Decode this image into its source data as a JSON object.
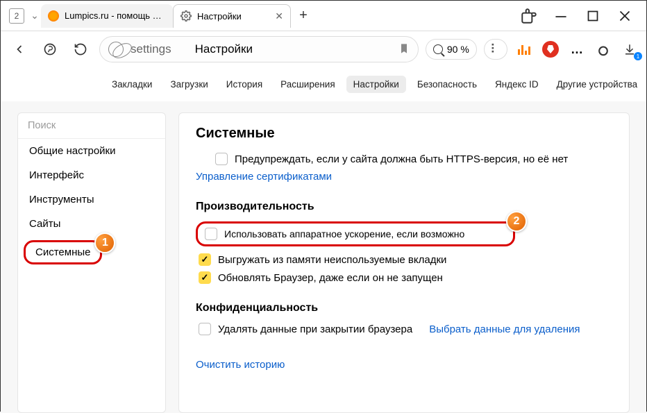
{
  "titlebar": {
    "tab_count": "2",
    "tab_inactive": "Lumpics.ru - помощь с компьютером",
    "tab_active": "Настройки"
  },
  "addressbar": {
    "host": "settings",
    "title": "Настройки",
    "zoom": "90 %",
    "download_badge": "1"
  },
  "nav": {
    "bookmarks": "Закладки",
    "downloads": "Загрузки",
    "history": "История",
    "extensions": "Расширения",
    "settings": "Настройки",
    "security": "Безопасность",
    "yandex_id": "Яндекс ID",
    "other_devices": "Другие устройства"
  },
  "sidebar": {
    "search_placeholder": "Поиск",
    "general": "Общие настройки",
    "interface": "Интерфейс",
    "tools": "Инструменты",
    "sites": "Сайты",
    "system": "Системные"
  },
  "annotations": {
    "one": "1",
    "two": "2"
  },
  "main": {
    "h_system": "Системные",
    "https_warn": "Предупреждать, если у сайта должна быть HTTPS-версия, но её нет",
    "cert_link": "Управление сертификатами",
    "h_perf": "Производительность",
    "hw_accel": "Использовать аппаратное ускорение, если возможно",
    "unload_tabs": "Выгружать из памяти неиспользуемые вкладки",
    "bg_update": "Обновлять Браузер, даже если он не запущен",
    "h_priv": "Конфиденциальность",
    "clear_on_close": "Удалять данные при закрытии браузера",
    "choose_data": "Выбрать данные для удаления",
    "clear_history": "Очистить историю"
  }
}
